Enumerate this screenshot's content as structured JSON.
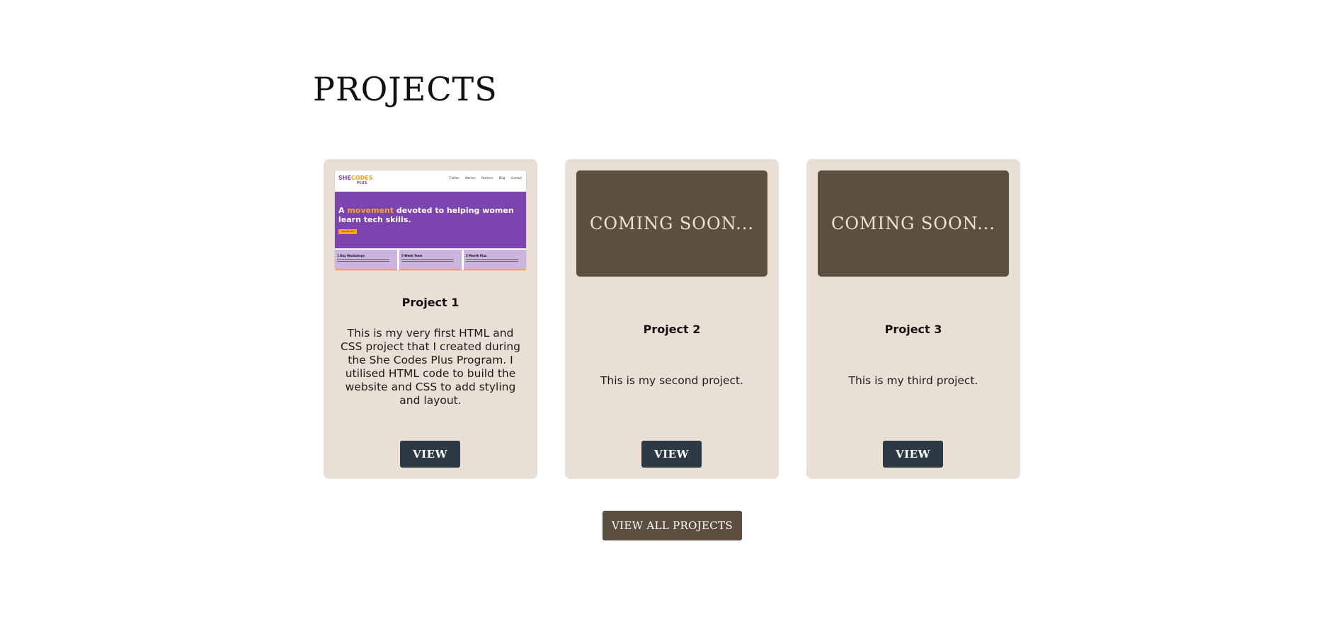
{
  "section": {
    "title": "PROJECTS",
    "view_all_label": "VIEW ALL PROJECTS"
  },
  "projects": [
    {
      "title": "Project 1",
      "description": "This is my very first HTML and CSS project that I created during the She Codes Plus Program. I utilised HTML code to build the website and CSS to add styling and layout.",
      "button_label": "VIEW",
      "thumbnail": {
        "type": "website-preview",
        "logo_she": "SHE",
        "logo_codes": "CODES",
        "logo_plus": "PLUS",
        "nav_links": [
          "Caitlen",
          "Women",
          "Partners",
          "Blog",
          "Contact"
        ],
        "hero_prefix": "A ",
        "hero_highlight": "movement",
        "hero_suffix": " devoted to helping women learn tech skills.",
        "hero_button": "Get started",
        "boxes": [
          "1 Day Workshops",
          "5 Week Team",
          "5 Month Plus"
        ]
      }
    },
    {
      "title": "Project 2",
      "description": "This is my second project.",
      "button_label": "VIEW",
      "thumbnail": {
        "type": "coming-soon",
        "text": "COMING SOON..."
      }
    },
    {
      "title": "Project 3",
      "description": "This is my third project.",
      "button_label": "VIEW",
      "thumbnail": {
        "type": "coming-soon",
        "text": "COMING SOON..."
      }
    }
  ],
  "colors": {
    "card_background": "#e9dfd4",
    "thumbnail_dark": "#5d4f40",
    "view_button": "#2b3a44",
    "view_all_button": "#5d4f40",
    "preview_purple": "#7d44b0",
    "preview_orange": "#f6a623"
  }
}
